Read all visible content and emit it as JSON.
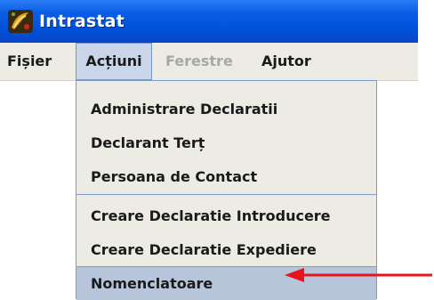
{
  "window": {
    "title": "Intrastat",
    "icon": "app-logo-icon"
  },
  "menubar": {
    "items": [
      {
        "label": "Fișier",
        "state": "normal"
      },
      {
        "label": "Acțiuni",
        "state": "open"
      },
      {
        "label": "Ferestre",
        "state": "disabled"
      },
      {
        "label": "Ajutor",
        "state": "normal"
      }
    ]
  },
  "dropdown": {
    "groups": [
      [
        "Administrare Declaratii",
        "Declarant Terț",
        "Persoana de Contact"
      ],
      [
        "Creare Declaratie Introducere",
        "Creare Declaratie Expediere"
      ],
      [
        "Nomenclatoare"
      ]
    ],
    "highlighted_item": "Nomenclatoare"
  },
  "annotation": {
    "type": "arrow",
    "color": "#e8141b",
    "points_to": "Nomenclatoare"
  },
  "colors": {
    "titlebar": "#0050d8",
    "menu_background": "#ecebe4",
    "highlight": "#b6c5da",
    "disabled_text": "#a8a8a8"
  }
}
